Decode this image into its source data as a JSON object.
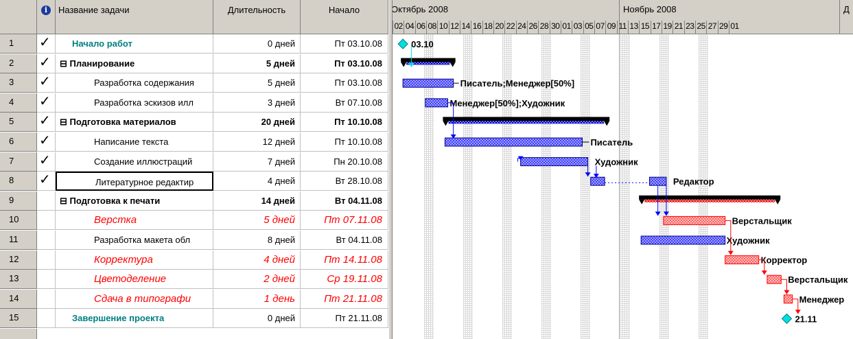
{
  "headers": {
    "info": "i",
    "name": "Название задачи",
    "duration": "Длительность",
    "start": "Начало"
  },
  "timescale": {
    "months": [
      "Октябрь 2008",
      "Ноябрь 2008",
      "Д"
    ],
    "days": [
      "02",
      "04",
      "06",
      "08",
      "10",
      "12",
      "14",
      "16",
      "18",
      "20",
      "22",
      "24",
      "26",
      "28",
      "30",
      "01",
      "03",
      "05",
      "07",
      "09",
      "11",
      "13",
      "15",
      "17",
      "19",
      "21",
      "23",
      "25",
      "27",
      "29",
      "01"
    ]
  },
  "tasks": [
    {
      "id": "1",
      "done": true,
      "name": "Начало работ",
      "duration": "0 дней",
      "start": "Пт 03.10.08",
      "style": "milestone"
    },
    {
      "id": "2",
      "done": true,
      "name": "⊟ Планирование",
      "duration": "5 дней",
      "start": "Пт 03.10.08",
      "style": "summary"
    },
    {
      "id": "3",
      "done": true,
      "name": "Разработка содержания",
      "duration": "5 дней",
      "start": "Пт 03.10.08",
      "style": "normal"
    },
    {
      "id": "4",
      "done": true,
      "name": "Разработка эскизов илл",
      "duration": "3 дней",
      "start": "Вт 07.10.08",
      "style": "normal"
    },
    {
      "id": "5",
      "done": true,
      "name": "⊟ Подготовка материалов",
      "duration": "20 дней",
      "start": "Пт 10.10.08",
      "style": "summary"
    },
    {
      "id": "6",
      "done": true,
      "name": "Написание текста",
      "duration": "12 дней",
      "start": "Пт 10.10.08",
      "style": "normal"
    },
    {
      "id": "7",
      "done": true,
      "name": "Создание иллюстраций",
      "duration": "7 дней",
      "start": "Пн 20.10.08",
      "style": "normal"
    },
    {
      "id": "8",
      "done": true,
      "name": "Литературное редактир",
      "duration": "4 дней",
      "start": "Вт 28.10.08",
      "style": "normal"
    },
    {
      "id": "9",
      "done": false,
      "name": "⊟ Подготовка к печати",
      "duration": "14 дней",
      "start": "Вт 04.11.08",
      "style": "summary"
    },
    {
      "id": "10",
      "done": false,
      "name": "Верстка",
      "duration": "5 дней",
      "start": "Пт 07.11.08",
      "style": "critical"
    },
    {
      "id": "11",
      "done": false,
      "name": "Разработка макета обл",
      "duration": "8 дней",
      "start": "Вт 04.11.08",
      "style": "normal"
    },
    {
      "id": "12",
      "done": false,
      "name": "Корректура",
      "duration": "4 дней",
      "start": "Пт 14.11.08",
      "style": "critical"
    },
    {
      "id": "13",
      "done": false,
      "name": "Цветоделение",
      "duration": "2 дней",
      "start": "Ср 19.11.08",
      "style": "critical"
    },
    {
      "id": "14",
      "done": false,
      "name": "Сдача в типографи",
      "duration": "1 день",
      "start": "Пт 21.11.08",
      "style": "critical"
    },
    {
      "id": "15",
      "done": false,
      "name": "Завершение проекта",
      "duration": "0 дней",
      "start": "Пт 21.11.08",
      "style": "milestone"
    }
  ],
  "bar_labels": {
    "t1": "03.10",
    "t3": "Писатель;Менеджер[50%]",
    "t4": "Менеджер[50%];Художник",
    "t6": "Писатель",
    "t7": "Художник",
    "t8": "Редактор",
    "t10": "Верстальщик",
    "t11": "Художник",
    "t12": "Корректор",
    "t13": "Верстальщик",
    "t14": "Менеджер",
    "t15": "21.11"
  },
  "colors": {
    "header": "#d4d0c8",
    "blue_bar": "#0000ff",
    "red_bar": "#ff0000",
    "teal": "#008080",
    "milestone": "#00e0e0"
  }
}
